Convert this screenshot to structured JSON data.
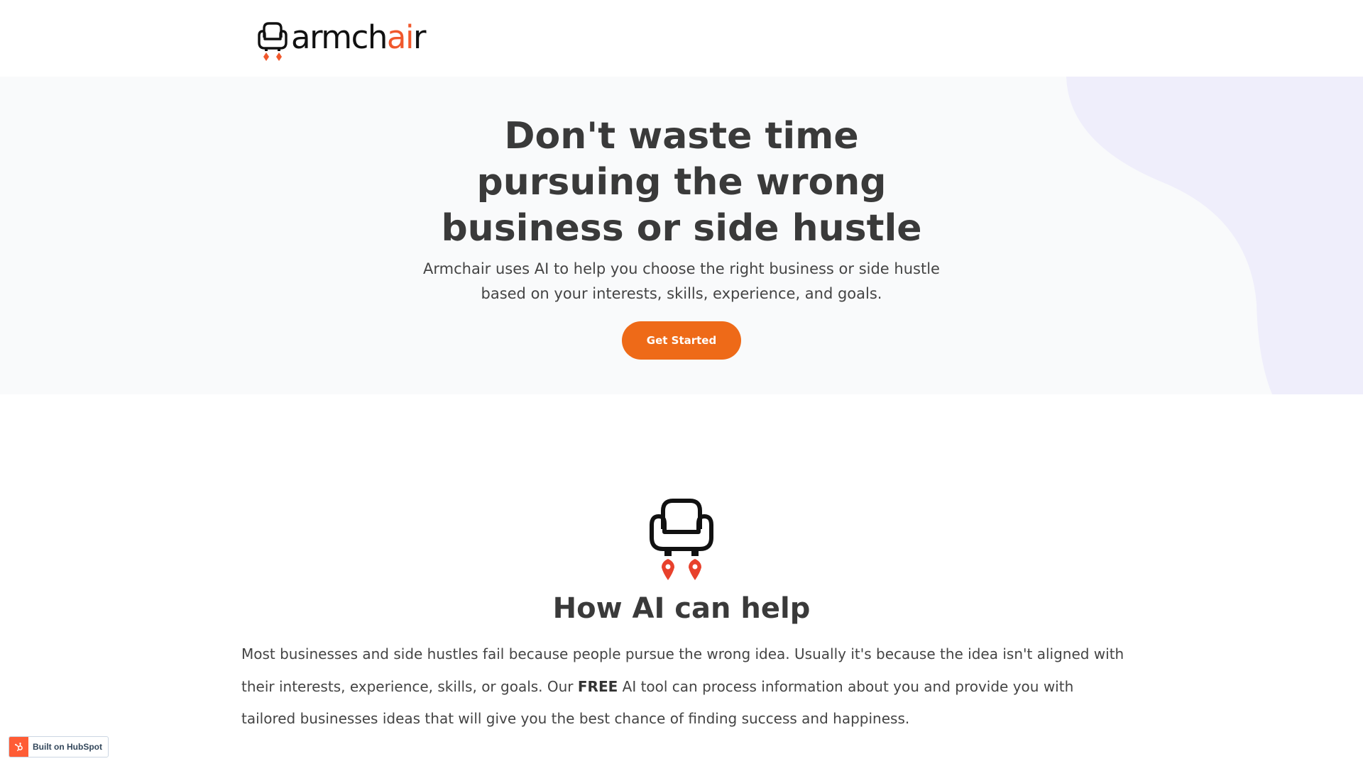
{
  "brand": {
    "name_part1": "armch",
    "name_part2": "ai",
    "name_part3": "r",
    "accent_color": "#f0582c",
    "icon": "armchair-rocket-icon"
  },
  "hero": {
    "title_lines": [
      "Don't waste time",
      "pursuing the wrong",
      "business or side hustle"
    ],
    "subtitle_lines": [
      "Armchair uses AI to help you choose the right business or side hustle",
      "based on your interests, skills, experience, and goals."
    ],
    "cta_label": "Get Started",
    "cta_color": "#ee6a18",
    "background_color": "#f9fafb",
    "blob_color": "#efeefb"
  },
  "how_ai": {
    "icon": "armchair-rocket-icon",
    "title": "How AI can help",
    "body_before": "Most businesses and side hustles fail because people pursue the wrong idea. Usually it's because the idea isn't aligned with their interests, experience, skills, or goals. Our ",
    "body_bold": "FREE",
    "body_after": " AI tool can process information about you and provide you with tailored businesses ideas that will give you the best chance of finding success and happiness."
  },
  "hubspot_badge": {
    "label": "Built on HubSpot",
    "icon": "hubspot-sprocket-icon",
    "color": "#ff5c35"
  }
}
